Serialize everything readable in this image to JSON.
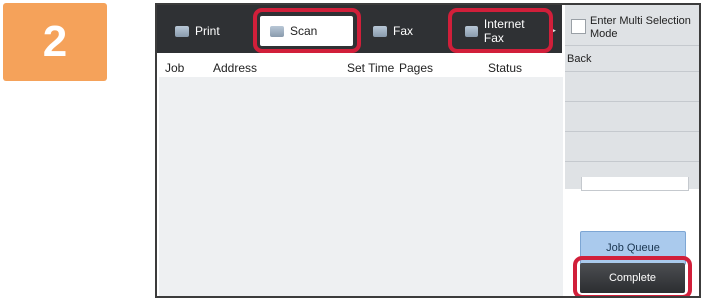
{
  "step": {
    "number": "2"
  },
  "tabs": [
    {
      "label": "Print",
      "icon": "printer-icon"
    },
    {
      "label": "Scan",
      "icon": "scanner-icon",
      "selected": true
    },
    {
      "label": "Fax",
      "icon": "fax-icon"
    },
    {
      "label": "Internet Fax",
      "icon": "internet-fax-icon"
    }
  ],
  "table": {
    "columns": [
      "Job",
      "Address",
      "Set Time",
      "Pages",
      "Status"
    ],
    "rows": []
  },
  "side": {
    "multi_select_label": "Enter Multi Selection Mode",
    "back_label": "Back"
  },
  "buttons": {
    "job_queue_label": "Job Queue",
    "complete_label": "Complete"
  },
  "colors": {
    "highlight": "#d11f3a",
    "step_badge": "#f5a25a",
    "tab_bar": "#2f3134",
    "job_queue_button": "#aacaed"
  }
}
